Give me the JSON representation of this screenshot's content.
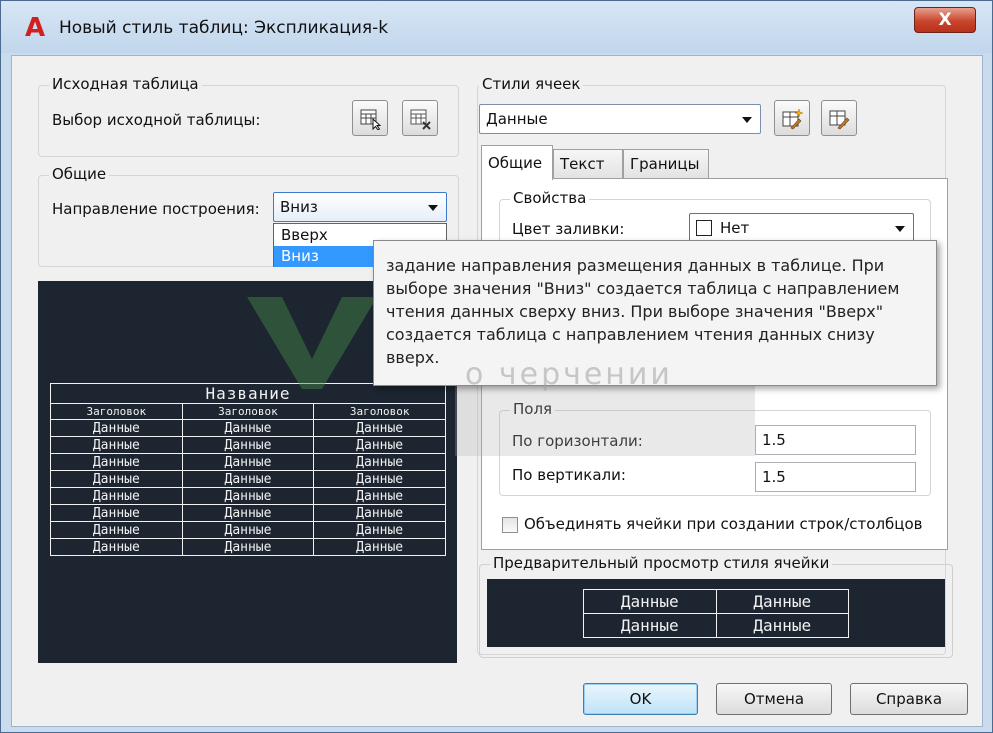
{
  "window": {
    "title": "Новый стиль таблиц: Экспликация-k",
    "app_icon": "autocad-icon",
    "close_label": "X"
  },
  "source_table": {
    "group_label": "Исходная таблица",
    "select_label": "Выбор исходной таблицы:",
    "buttons": [
      "select-table-icon",
      "remove-table-icon"
    ]
  },
  "general": {
    "group_label": "Общие",
    "direction_label": "Направление построения:",
    "direction_value": "Вниз",
    "dropdown_options": [
      "Вверх",
      "Вниз"
    ],
    "dropdown_selected": "Вниз"
  },
  "table_preview": {
    "title": "Название",
    "headers": [
      "Заголовок",
      "Заголовок",
      "Заголовок"
    ],
    "rows": [
      [
        "Данные",
        "Данные",
        "Данные"
      ],
      [
        "Данные",
        "Данные",
        "Данные"
      ],
      [
        "Данные",
        "Данные",
        "Данные"
      ],
      [
        "Данные",
        "Данные",
        "Данные"
      ],
      [
        "Данные",
        "Данные",
        "Данные"
      ],
      [
        "Данные",
        "Данные",
        "Данные"
      ],
      [
        "Данные",
        "Данные",
        "Данные"
      ],
      [
        "Данные",
        "Данные",
        "Данные"
      ]
    ]
  },
  "cell_styles": {
    "group_label": "Стили ячеек",
    "value": "Данные",
    "buttons": [
      "create-cell-style-icon",
      "manage-cell-styles-icon"
    ],
    "tabs": [
      "Общие",
      "Текст",
      "Границы"
    ],
    "active_tab": "Общие",
    "properties_label": "Свойства",
    "fill_label": "Цвет заливки:",
    "fill_value": "Нет",
    "margins_label": "Поля",
    "horizontal_label": "По горизонтали:",
    "horizontal_value": "1.5",
    "vertical_label": "По вертикали:",
    "vertical_value": "1.5",
    "merge_label": "Объединять ячейки при создании строк/столбцов",
    "merge_checked": false
  },
  "tooltip": {
    "text": "задание направления размещения данных в таблице. При выборе значения \"Вниз\" создается таблица с направлением чтения данных сверху вниз. При выборе значения \"Вверх\" создается таблица с направлением чтения данных снизу вверх."
  },
  "watermark": {
    "text": "о черчении"
  },
  "cell_preview": {
    "group_label": "Предварительный просмотр стиля ячейки",
    "cells": [
      [
        "Данные",
        "Данные"
      ],
      [
        "Данные",
        "Данные"
      ]
    ]
  },
  "buttons": {
    "ok": "OK",
    "cancel": "Отмена",
    "help": "Справка"
  },
  "colors": {
    "selection": "#3399ff",
    "preview_background": "#1c2530",
    "close_button": "#c9452c"
  }
}
